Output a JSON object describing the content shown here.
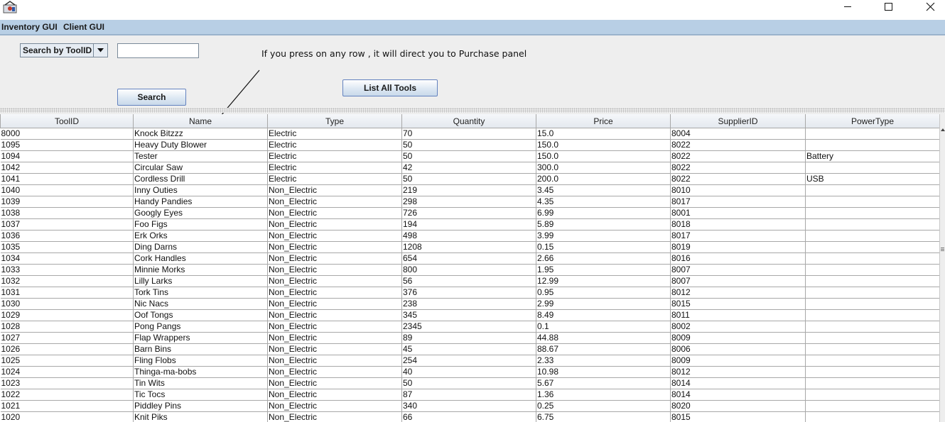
{
  "window": {
    "icons": {
      "app": "java-app-icon",
      "minimize": "minimize-icon",
      "maximize": "maximize-icon",
      "close": "close-icon"
    }
  },
  "menu": {
    "items": [
      "Inventory GUI",
      "Client GUI"
    ]
  },
  "search": {
    "combo_selected": "Search by ToolID",
    "input_value": "",
    "search_button": "Search",
    "list_all_button": "List All Tools"
  },
  "annotation": "If you press on any row , it will direct you to Purchase panel",
  "table": {
    "columns": [
      "ToolID",
      "Name",
      "Type",
      "Quantity",
      "Price",
      "SupplierID",
      "PowerType"
    ],
    "rows": [
      [
        "8000",
        "Knock Bitzzz",
        "Electric",
        "70",
        "15.0",
        "8004",
        ""
      ],
      [
        "1095",
        "Heavy Duty Blower",
        "Electric",
        "50",
        "150.0",
        "8022",
        ""
      ],
      [
        "1094",
        "Tester",
        "Electric",
        "50",
        "150.0",
        "8022",
        "Battery"
      ],
      [
        "1042",
        "Circular Saw",
        "Electric",
        "42",
        "300.0",
        "8022",
        ""
      ],
      [
        "1041",
        "Cordless Drill",
        "Electric",
        "50",
        "200.0",
        "8022",
        "USB"
      ],
      [
        "1040",
        "Inny Outies",
        "Non_Electric",
        "219",
        "3.45",
        "8010",
        ""
      ],
      [
        "1039",
        "Handy Pandies",
        "Non_Electric",
        "298",
        "4.35",
        "8017",
        ""
      ],
      [
        "1038",
        "Googly Eyes",
        "Non_Electric",
        "726",
        "6.99",
        "8001",
        ""
      ],
      [
        "1037",
        "Foo Figs",
        "Non_Electric",
        "194",
        "5.89",
        "8018",
        ""
      ],
      [
        "1036",
        "Erk Orks",
        "Non_Electric",
        "498",
        "3.99",
        "8017",
        ""
      ],
      [
        "1035",
        "Ding Darns",
        "Non_Electric",
        "1208",
        "0.15",
        "8019",
        ""
      ],
      [
        "1034",
        "Cork Handles",
        "Non_Electric",
        "654",
        "2.66",
        "8016",
        ""
      ],
      [
        "1033",
        "Minnie Morks",
        "Non_Electric",
        "800",
        "1.95",
        "8007",
        ""
      ],
      [
        "1032",
        "Lilly Larks",
        "Non_Electric",
        "56",
        "12.99",
        "8007",
        ""
      ],
      [
        "1031",
        "Tork Tins",
        "Non_Electric",
        "376",
        "0.95",
        "8012",
        ""
      ],
      [
        "1030",
        "Nic Nacs",
        "Non_Electric",
        "238",
        "2.99",
        "8015",
        ""
      ],
      [
        "1029",
        "Oof Tongs",
        "Non_Electric",
        "345",
        "8.49",
        "8011",
        ""
      ],
      [
        "1028",
        "Pong Pangs",
        "Non_Electric",
        "2345",
        "0.1",
        "8002",
        ""
      ],
      [
        "1027",
        "Flap Wrappers",
        "Non_Electric",
        "89",
        "44.88",
        "8009",
        ""
      ],
      [
        "1026",
        "Barn Bins",
        "Non_Electric",
        "45",
        "88.67",
        "8006",
        ""
      ],
      [
        "1025",
        "Fling Flobs",
        "Non_Electric",
        "254",
        "2.33",
        "8009",
        ""
      ],
      [
        "1024",
        "Thinga-ma-bobs",
        "Non_Electric",
        "40",
        "10.98",
        "8012",
        ""
      ],
      [
        "1023",
        "Tin Wits",
        "Non_Electric",
        "50",
        "5.67",
        "8014",
        ""
      ],
      [
        "1022",
        "Tic Tocs",
        "Non_Electric",
        "87",
        "1.36",
        "8014",
        ""
      ],
      [
        "1021",
        "Piddley Pins",
        "Non_Electric",
        "340",
        "0.25",
        "8020",
        ""
      ],
      [
        "1020",
        "Knit Piks",
        "Non_Electric",
        "66",
        "6.75",
        "8015",
        ""
      ]
    ]
  }
}
